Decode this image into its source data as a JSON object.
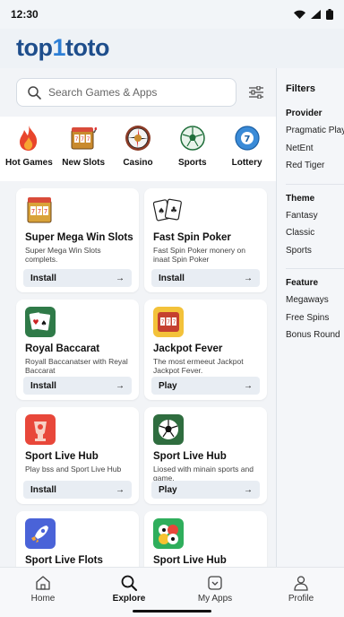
{
  "status_bar": {
    "time": "12:30"
  },
  "brand": {
    "part1": "top",
    "part2": "1",
    "part3": "toto"
  },
  "search": {
    "placeholder": "Search Games & Apps"
  },
  "categories": [
    {
      "label": "Hot Games",
      "icon": "flame-icon"
    },
    {
      "label": "New Slots",
      "icon": "slot-machine-icon"
    },
    {
      "label": "Casino",
      "icon": "roulette-icon"
    },
    {
      "label": "Sports",
      "icon": "soccer-ball-icon"
    },
    {
      "label": "Lottery",
      "icon": "lottery-ball-icon"
    }
  ],
  "cards": [
    {
      "title": "Super Mega Win Slots",
      "desc": "Super Mega Win Slots complets.",
      "button": "Install",
      "icon": "slot-machine-icon"
    },
    {
      "title": "Fast Spin Poker",
      "desc": "Fast Spin Poker monery on inaat Spin Poker",
      "button": "Install",
      "icon": "playing-cards-icon"
    },
    {
      "title": "Royal Baccarat",
      "desc": "Royall Baccanatser with Reyal Baccarat",
      "button": "Install",
      "icon": "cards-icon"
    },
    {
      "title": "Jackpot Fever",
      "desc": "The most ermeeut Jackpot Jackpot Fever.",
      "button": "Play",
      "icon": "jackpot-icon"
    },
    {
      "title": "Sport Live Hub",
      "desc": "Play bss and Sport Live Hub",
      "button": "Install",
      "icon": "sport-cup-icon"
    },
    {
      "title": "Sport Live Hub",
      "desc": "Liosed with minain sports and game.",
      "button": "Play",
      "icon": "soccer-ball-icon"
    },
    {
      "title": "Sport Live Flots",
      "desc": "",
      "button": "",
      "icon": "rocket-icon"
    },
    {
      "title": "Sport Live Hub",
      "desc": "",
      "button": "",
      "icon": "balls-icon"
    }
  ],
  "filters": {
    "title": "Filters",
    "groups": [
      {
        "title": "Provider",
        "options": [
          "Pragmatic Play",
          "NetEnt",
          "Red Tiger"
        ]
      },
      {
        "title": "Theme",
        "options": [
          "Fantasy",
          "Classic",
          "Sports"
        ]
      },
      {
        "title": "Feature",
        "options": [
          "Megaways",
          "Free Spins",
          "Bonus Round"
        ]
      }
    ]
  },
  "nav": [
    {
      "label": "Home",
      "icon": "home-icon"
    },
    {
      "label": "Explore",
      "icon": "search-icon",
      "active": true
    },
    {
      "label": "My Apps",
      "icon": "my-apps-icon"
    },
    {
      "label": "Profile",
      "icon": "profile-icon"
    }
  ],
  "colors": {
    "brand_dark": "#1e4e8c",
    "brand_accent": "#2d7fd6",
    "button_bg": "#e8edf3"
  }
}
